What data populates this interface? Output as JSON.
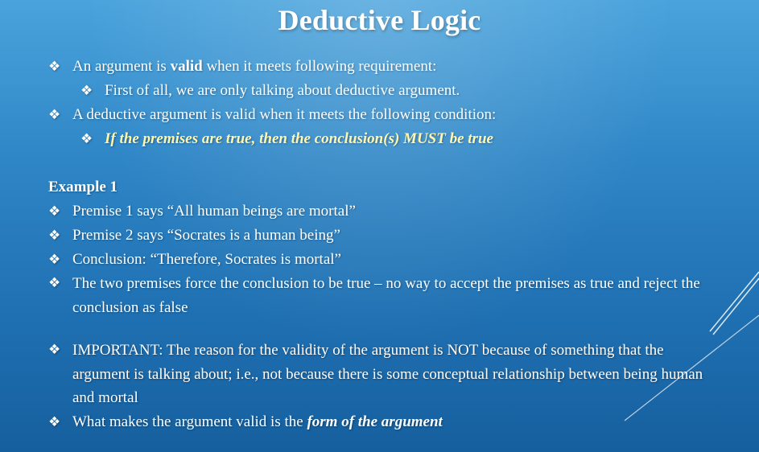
{
  "title": "Deductive Logic",
  "bullets": {
    "b1_prefix": "An argument is ",
    "b1_bold": "valid",
    "b1_suffix": " when it meets following requirement:",
    "b1_sub": "First of all, we are only talking about deductive argument.",
    "b2": "A deductive argument is valid when it meets the following condition:",
    "b2_sub": "If the premises are true, then the conclusion(s) MUST be true"
  },
  "example": {
    "heading": "Example 1",
    "premise1": "Premise 1 says “All human beings are mortal”",
    "premise2": "Premise 2 says “Socrates is a human being”",
    "conclusion": "Conclusion: “Therefore, Socrates is mortal”",
    "force": "The two premises force the conclusion to be true – no way to accept the premises as true and reject the conclusion as false"
  },
  "notes": {
    "important": "IMPORTANT: The reason for the validity of the argument is NOT because of something that the argument is talking about; i.e., not because there is some conceptual relationship between being human and mortal",
    "form_prefix": "What makes the argument valid is the ",
    "form_emph": "form of the argument"
  },
  "bullet_glyph": "❖",
  "colors": {
    "background_top": "#4aa3dc",
    "background_bottom": "#165f9e",
    "text": "#ffffff",
    "highlight": "#fff6a8"
  }
}
